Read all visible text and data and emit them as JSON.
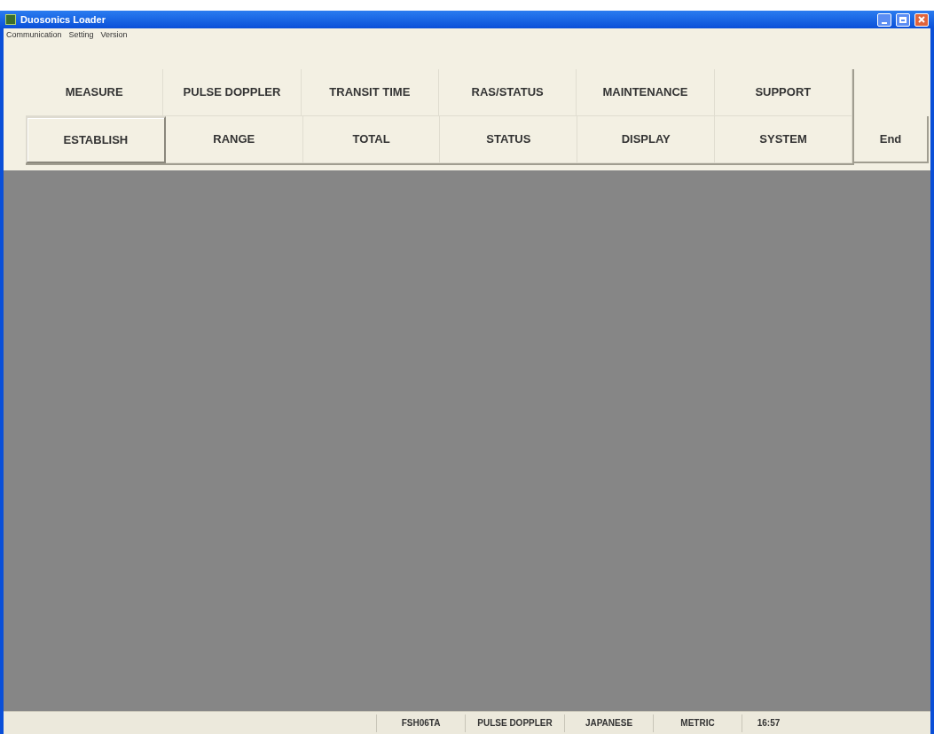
{
  "window": {
    "title": "Duosonics Loader"
  },
  "menu": [
    "Communication",
    "Setting",
    "Version"
  ],
  "function_buttons": [
    [
      {
        "label": "MEASURE",
        "selected": false
      },
      {
        "label": "PULSE DOPPLER",
        "selected": false
      },
      {
        "label": "TRANSIT TIME",
        "selected": false
      },
      {
        "label": "RAS/STATUS",
        "selected": false
      },
      {
        "label": "MAINTENANCE",
        "selected": false
      },
      {
        "label": "SUPPORT",
        "selected": false
      }
    ],
    [
      {
        "label": "ESTABLISH",
        "selected": true
      },
      {
        "label": "RANGE",
        "selected": false
      },
      {
        "label": "TOTAL",
        "selected": false
      },
      {
        "label": "STATUS",
        "selected": false
      },
      {
        "label": "DISPLAY",
        "selected": false
      },
      {
        "label": "SYSTEM",
        "selected": false
      }
    ]
  ],
  "end_button": "End",
  "status_bar": [
    "FSH06TA",
    "PULSE DOPPLER",
    "JAPANESE",
    "METRIC",
    "16:57"
  ]
}
